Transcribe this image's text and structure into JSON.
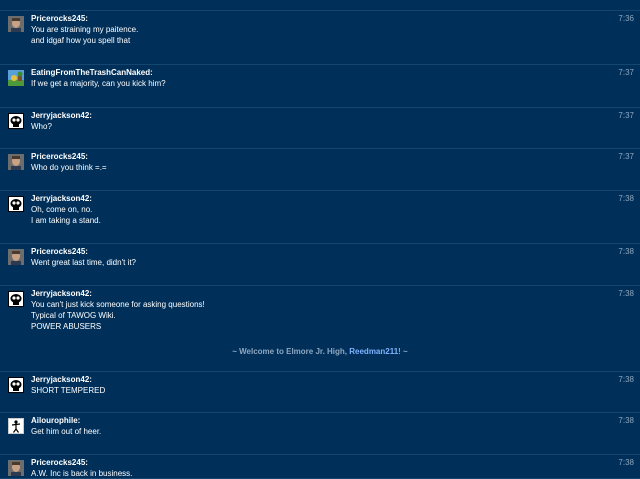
{
  "messages": [
    {
      "user": "Pricerocks245:",
      "avatar": "photo-avatar-icon",
      "time": "7:36",
      "lines": [
        "You are straining my paitence.",
        "and idgaf how you spell that"
      ]
    },
    {
      "user": "EatingFromTheTrashCanNaked:",
      "avatar": "cartoon-avatar-icon",
      "time": "7:37",
      "lines": [
        "If we get a majority, can you kick him?"
      ]
    },
    {
      "user": "Jerryjackson42:",
      "avatar": "skull-avatar-icon",
      "time": "7:37",
      "lines": [
        "Who?"
      ]
    },
    {
      "user": "Pricerocks245:",
      "avatar": "photo-avatar-icon",
      "time": "7:37",
      "lines": [
        "Who do you think =.="
      ]
    },
    {
      "user": "Jerryjackson42:",
      "avatar": "skull-avatar-icon",
      "time": "7:38",
      "lines": [
        "Oh, come on, no.",
        "I am taking a stand."
      ]
    },
    {
      "user": "Pricerocks245:",
      "avatar": "photo-avatar-icon",
      "time": "7:38",
      "lines": [
        "Went great last time, didn't it?"
      ]
    },
    {
      "user": "Jerryjackson42:",
      "avatar": "skull-avatar-icon",
      "time": "7:38",
      "lines": [
        "You can't just kick someone for asking questions!",
        "Typical of TAWOG Wiki.",
        "POWER ABUSERS"
      ]
    },
    {
      "user": "Jerryjackson42:",
      "avatar": "skull-avatar-icon",
      "time": "7:38",
      "lines": [
        "SHORT TEMPERED"
      ]
    },
    {
      "user": "Ailourophile:",
      "avatar": "figure-avatar-icon",
      "time": "7:38",
      "lines": [
        "Get him out of heer."
      ]
    },
    {
      "user": "Pricerocks245:",
      "avatar": "photo-avatar-icon",
      "time": "7:38",
      "lines": [
        "A.W. Inc is back in business."
      ]
    }
  ],
  "system": {
    "prefix": "~ Welcome to Elmore Jr. High, ",
    "user": "Reedman211",
    "suffix": "! ~"
  },
  "colors": {
    "background": "#00305a",
    "divider": "#14466f",
    "timestamp": "#8ea7c0",
    "username_link": "#7fb2ff"
  }
}
